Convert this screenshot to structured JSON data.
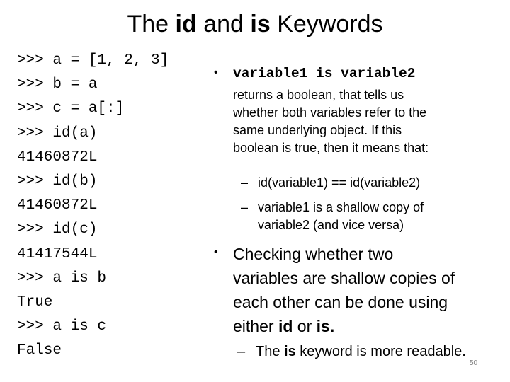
{
  "title": {
    "part1": "The ",
    "bold1": "id",
    "part2": " and ",
    "bold2": "is",
    "part3": " Keywords"
  },
  "code_lines": [
    ">>> a = [1, 2, 3]",
    ">>> b = a",
    ">>> c = a[:]",
    ">>> id(a)",
    "41460872L",
    ">>> id(b)",
    "41460872L",
    ">>> id(c)",
    "41417544L",
    ">>> a is b",
    "True",
    ">>> a is c",
    "False"
  ],
  "bullets": {
    "first": {
      "bullet_glyph": "•",
      "code": "variable1 is variable2",
      "lines": [
        "returns a boolean, that tells us",
        "whether both variables refer to the",
        "same underlying object. If this",
        "boolean is true, then it means that:"
      ],
      "sub_items": [
        {
          "dash": "–",
          "lines": [
            "id(variable1) == id(variable2)"
          ]
        },
        {
          "dash": "–",
          "lines": [
            "variable1 is a shallow copy of",
            "variable2 (and vice versa)"
          ]
        }
      ]
    },
    "second": {
      "bullet_glyph": "•",
      "line1": "Checking whether two",
      "line2": "variables are shallow copies of",
      "line3": "each other can be done using",
      "line4_prefix": "either ",
      "line4_bold1": "id",
      "line4_mid": " or ",
      "line4_bold2": "is",
      "line4_suffix": ".",
      "sub_item": {
        "dash": "–",
        "prefix": "The ",
        "bold": "is",
        "suffix": " keyword is more readable."
      }
    }
  },
  "page_number": "50"
}
